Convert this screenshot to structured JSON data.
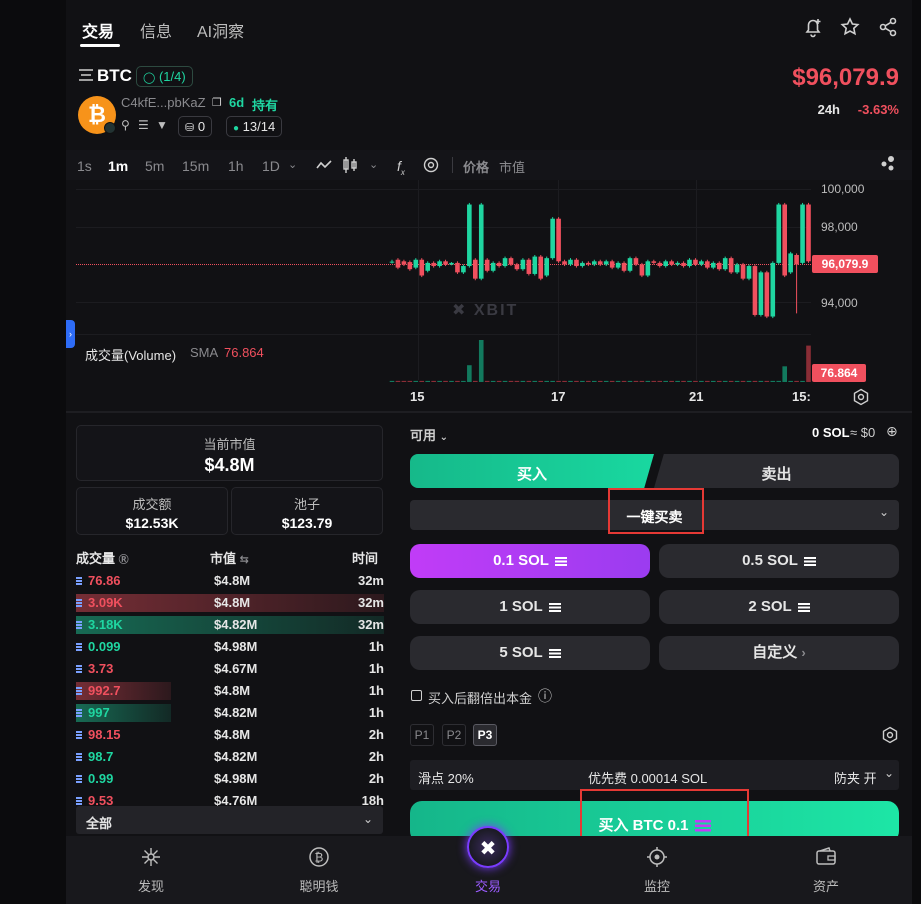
{
  "top_tabs": {
    "trade": "交易",
    "info": "信息",
    "ai": "AI洞察"
  },
  "token": {
    "symbol": "BTC",
    "verify_badge": "(1/4)",
    "address": "C4kfE...pbKaZ",
    "age": "6d",
    "holding": "持有",
    "wallet_count": "0",
    "score": "13/14",
    "price": "$96,079.9",
    "change_period": "24h",
    "change": "-3.63%"
  },
  "chart_toolbar": {
    "timeframes": [
      "1s",
      "1m",
      "5m",
      "15m",
      "1h",
      "1D"
    ],
    "active_tf": "1m",
    "price_label": "价格",
    "mcap_label": "市值"
  },
  "chart_data": {
    "type": "candlestick",
    "y_ticks": [
      "100,000",
      "98,000",
      "94,000"
    ],
    "ylim": [
      92000,
      101000
    ],
    "current_price_label": "96,079.9",
    "x_ticks": [
      "15",
      "17",
      "21",
      "15:"
    ],
    "watermark": "XBIT",
    "volume_title": "成交量(Volume)",
    "volume_sma_label": "SMA",
    "volume_sma_value": "76.864",
    "volume_current_label": "76.864",
    "candles": [
      {
        "o": 96080,
        "c": 96080,
        "h": 96200,
        "l": 95950
      },
      {
        "o": 96200,
        "c": 95700,
        "h": 96300,
        "l": 95600
      },
      {
        "o": 96100,
        "c": 95900,
        "h": 96200,
        "l": 95800
      },
      {
        "o": 96050,
        "c": 95600,
        "h": 96150,
        "l": 95500
      },
      {
        "o": 95700,
        "c": 96200,
        "h": 96300,
        "l": 95600
      },
      {
        "o": 96200,
        "c": 95200,
        "h": 96300,
        "l": 95100
      },
      {
        "o": 95500,
        "c": 96000,
        "h": 96100,
        "l": 95400
      },
      {
        "o": 96000,
        "c": 95800,
        "h": 96100,
        "l": 95700
      },
      {
        "o": 95800,
        "c": 96100,
        "h": 96200,
        "l": 95700
      },
      {
        "o": 96100,
        "c": 95900,
        "h": 96200,
        "l": 95800
      },
      {
        "o": 95900,
        "c": 96000,
        "h": 96050,
        "l": 95850
      },
      {
        "o": 96000,
        "c": 95400,
        "h": 96100,
        "l": 95300
      },
      {
        "o": 95400,
        "c": 95800,
        "h": 95900,
        "l": 95300
      },
      {
        "o": 95800,
        "c": 99700,
        "h": 99800,
        "l": 95700
      },
      {
        "o": 96200,
        "c": 95000,
        "h": 96300,
        "l": 94900
      },
      {
        "o": 95000,
        "c": 99700,
        "h": 99800,
        "l": 94900
      },
      {
        "o": 96200,
        "c": 95500,
        "h": 96300,
        "l": 95400
      },
      {
        "o": 95500,
        "c": 96000,
        "h": 96100,
        "l": 95400
      },
      {
        "o": 96000,
        "c": 95800,
        "h": 96100,
        "l": 95700
      },
      {
        "o": 95800,
        "c": 96300,
        "h": 96400,
        "l": 95700
      },
      {
        "o": 96300,
        "c": 95900,
        "h": 96400,
        "l": 95800
      },
      {
        "o": 95900,
        "c": 95600,
        "h": 96000,
        "l": 95500
      },
      {
        "o": 95600,
        "c": 96200,
        "h": 96300,
        "l": 95500
      },
      {
        "o": 96200,
        "c": 95300,
        "h": 96300,
        "l": 95200
      },
      {
        "o": 95300,
        "c": 96400,
        "h": 96500,
        "l": 95200
      },
      {
        "o": 96400,
        "c": 95000,
        "h": 96500,
        "l": 94900
      },
      {
        "o": 95200,
        "c": 96300,
        "h": 96400,
        "l": 95100
      },
      {
        "o": 96300,
        "c": 98800,
        "h": 98900,
        "l": 96200
      },
      {
        "o": 98800,
        "c": 96100,
        "h": 98900,
        "l": 96000
      },
      {
        "o": 96100,
        "c": 95900,
        "h": 96200,
        "l": 95800
      },
      {
        "o": 95900,
        "c": 96200,
        "h": 96300,
        "l": 95800
      },
      {
        "o": 96200,
        "c": 95800,
        "h": 96300,
        "l": 95700
      },
      {
        "o": 95800,
        "c": 96000,
        "h": 96100,
        "l": 95700
      },
      {
        "o": 96000,
        "c": 95900,
        "h": 96100,
        "l": 95800
      },
      {
        "o": 95900,
        "c": 96100,
        "h": 96200,
        "l": 95800
      },
      {
        "o": 96100,
        "c": 95900,
        "h": 96200,
        "l": 95800
      },
      {
        "o": 95900,
        "c": 96100,
        "h": 96200,
        "l": 95800
      },
      {
        "o": 96100,
        "c": 95700,
        "h": 96200,
        "l": 95600
      },
      {
        "o": 95700,
        "c": 96000,
        "h": 96100,
        "l": 95600
      },
      {
        "o": 96000,
        "c": 95500,
        "h": 96100,
        "l": 95400
      },
      {
        "o": 95500,
        "c": 96300,
        "h": 96400,
        "l": 95400
      },
      {
        "o": 96300,
        "c": 95900,
        "h": 96400,
        "l": 95800
      },
      {
        "o": 95900,
        "c": 95200,
        "h": 96000,
        "l": 95100
      },
      {
        "o": 95200,
        "c": 96100,
        "h": 96200,
        "l": 95100
      },
      {
        "o": 96100,
        "c": 96000,
        "h": 96200,
        "l": 95900
      },
      {
        "o": 96000,
        "c": 95800,
        "h": 96100,
        "l": 95700
      },
      {
        "o": 95800,
        "c": 96100,
        "h": 96200,
        "l": 95700
      },
      {
        "o": 96100,
        "c": 95900,
        "h": 96200,
        "l": 95800
      },
      {
        "o": 95900,
        "c": 96000,
        "h": 96100,
        "l": 95800
      },
      {
        "o": 96000,
        "c": 95800,
        "h": 96100,
        "l": 95700
      },
      {
        "o": 95800,
        "c": 96200,
        "h": 96300,
        "l": 95700
      },
      {
        "o": 96200,
        "c": 95900,
        "h": 96300,
        "l": 95800
      },
      {
        "o": 95900,
        "c": 96100,
        "h": 96200,
        "l": 95800
      },
      {
        "o": 96100,
        "c": 95700,
        "h": 96200,
        "l": 95600
      },
      {
        "o": 95700,
        "c": 96000,
        "h": 96100,
        "l": 95600
      },
      {
        "o": 96000,
        "c": 95600,
        "h": 96100,
        "l": 95500
      },
      {
        "o": 95600,
        "c": 96300,
        "h": 96400,
        "l": 95500
      },
      {
        "o": 96300,
        "c": 95400,
        "h": 96400,
        "l": 95300
      },
      {
        "o": 95400,
        "c": 95900,
        "h": 96000,
        "l": 95300
      },
      {
        "o": 95900,
        "c": 95000,
        "h": 96000,
        "l": 94900
      },
      {
        "o": 95000,
        "c": 95800,
        "h": 95900,
        "l": 94900
      },
      {
        "o": 95800,
        "c": 92700,
        "h": 95900,
        "l": 92600
      },
      {
        "o": 92700,
        "c": 95400,
        "h": 95500,
        "l": 92600
      },
      {
        "o": 95400,
        "c": 92600,
        "h": 95500,
        "l": 92500
      },
      {
        "o": 92600,
        "c": 96000,
        "h": 96100,
        "l": 92500
      },
      {
        "o": 96000,
        "c": 99700,
        "h": 99800,
        "l": 95900
      },
      {
        "o": 99700,
        "c": 95200,
        "h": 99800,
        "l": 95100
      },
      {
        "o": 95400,
        "c": 96600,
        "h": 96700,
        "l": 95300
      },
      {
        "o": 96500,
        "c": 95900,
        "h": 96600,
        "l": 92800
      },
      {
        "o": 96000,
        "c": 99700,
        "h": 99800,
        "l": 95900
      },
      {
        "o": 99700,
        "c": 96100,
        "h": 99800,
        "l": 96000
      }
    ],
    "volume_spikes": [
      {
        "index": 13,
        "value": 60,
        "dir": "up"
      },
      {
        "index": 15,
        "value": 150,
        "dir": "up"
      },
      {
        "index": 66,
        "value": 56,
        "dir": "up"
      },
      {
        "index": 70,
        "value": 130,
        "dir": "down"
      }
    ]
  },
  "stats": {
    "mcap_label": "当前市值",
    "mcap": "$4.8M",
    "volume_label": "成交额",
    "volume": "$12.53K",
    "pool_label": "池子",
    "pool": "$123.79"
  },
  "trades_header": {
    "vol": "成交量",
    "mcap": "市值",
    "time": "时间"
  },
  "trades": [
    {
      "vol": "76.86",
      "mcap": "$4.8M",
      "time": "32m",
      "side": "sell",
      "bar": 0
    },
    {
      "vol": "3.09K",
      "mcap": "$4.8M",
      "time": "32m",
      "side": "sell",
      "bar": 1.0
    },
    {
      "vol": "3.18K",
      "mcap": "$4.82M",
      "time": "32m",
      "side": "buy",
      "bar": 1.0
    },
    {
      "vol": "0.099",
      "mcap": "$4.98M",
      "time": "1h",
      "side": "buy",
      "bar": 0
    },
    {
      "vol": "3.73",
      "mcap": "$4.67M",
      "time": "1h",
      "side": "sell",
      "bar": 0
    },
    {
      "vol": "992.7",
      "mcap": "$4.8M",
      "time": "1h",
      "side": "sell",
      "bar": 0.31
    },
    {
      "vol": "997",
      "mcap": "$4.82M",
      "time": "1h",
      "side": "buy",
      "bar": 0.31
    },
    {
      "vol": "98.15",
      "mcap": "$4.8M",
      "time": "2h",
      "side": "sell",
      "bar": 0
    },
    {
      "vol": "98.7",
      "mcap": "$4.82M",
      "time": "2h",
      "side": "buy",
      "bar": 0
    },
    {
      "vol": "0.99",
      "mcap": "$4.98M",
      "time": "2h",
      "side": "buy",
      "bar": 0
    },
    {
      "vol": "9.53",
      "mcap": "$4.76M",
      "time": "18h",
      "side": "sell",
      "bar": 0
    }
  ],
  "filter": {
    "label": "全部"
  },
  "trade_panel": {
    "available_label": "可用",
    "balance": "0 SOL",
    "approx": "≈ $0",
    "buy_tab": "买入",
    "sell_tab": "卖出",
    "mode": "一键买卖",
    "amounts": [
      "0.1 SOL",
      "0.5 SOL",
      "1 SOL",
      "2 SOL",
      "5 SOL"
    ],
    "custom": "自定义",
    "double_label": "买入后翻倍出本金",
    "presets": [
      "P1",
      "P2",
      "P3"
    ],
    "slippage": "滑点 20%",
    "priority": "优先费 0.00014 SOL",
    "mev": "防夹 开",
    "submit": "买入 BTC 0.1"
  },
  "bottom_nav": {
    "discover": "发现",
    "smart": "聪明钱",
    "trade": "交易",
    "monitor": "监控",
    "assets": "资产"
  },
  "colors": {
    "up": "#1fd6a1",
    "down": "#f0505e",
    "accent": "#c13cf7"
  }
}
